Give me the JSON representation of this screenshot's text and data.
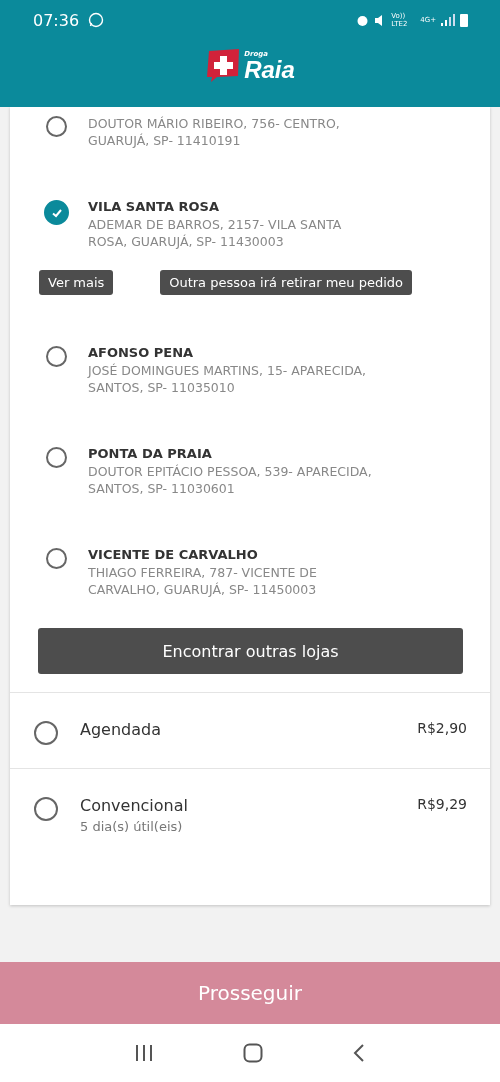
{
  "status_bar": {
    "time": "07:36",
    "network_label": "Vo)) LTE2",
    "network_type": "4G+"
  },
  "logo": {
    "small": "Droga",
    "big": "Raia"
  },
  "stores": [
    {
      "address": "DOUTOR MÁRIO RIBEIRO, 756- CENTRO, GUARUJÁ, SP- 11410191",
      "selected": false
    },
    {
      "name": "VILA SANTA ROSA",
      "address": "ADEMAR DE BARROS, 2157- VILA SANTA ROSA, GUARUJÁ, SP- 11430003",
      "selected": true
    },
    {
      "name": "AFONSO PENA",
      "address": "JOSÉ DOMINGUES MARTINS, 15- APARECIDA, SANTOS, SP- 11035010",
      "selected": false
    },
    {
      "name": "PONTA DA PRAIA",
      "address": "DOUTOR EPITÁCIO PESSOA, 539- APARECIDA, SANTOS, SP- 11030601",
      "selected": false
    },
    {
      "name": "VICENTE DE CARVALHO",
      "address": "THIAGO FERREIRA, 787- VICENTE DE CARVALHO, GUARUJÁ, SP- 11450003",
      "selected": false
    }
  ],
  "selected_store_actions": [
    "Ver mais",
    "Outra pessoa irá retirar meu pedido"
  ],
  "find_stores_button": "Encontrar outras lojas",
  "shipping_options": [
    {
      "name": "Agendada",
      "price": "R$2,90",
      "selected": false
    },
    {
      "name": "Convencional",
      "price": "R$9,29",
      "note": "5 dia(s) útil(eis)",
      "selected": false
    }
  ],
  "proceed_button": "Prosseguir"
}
